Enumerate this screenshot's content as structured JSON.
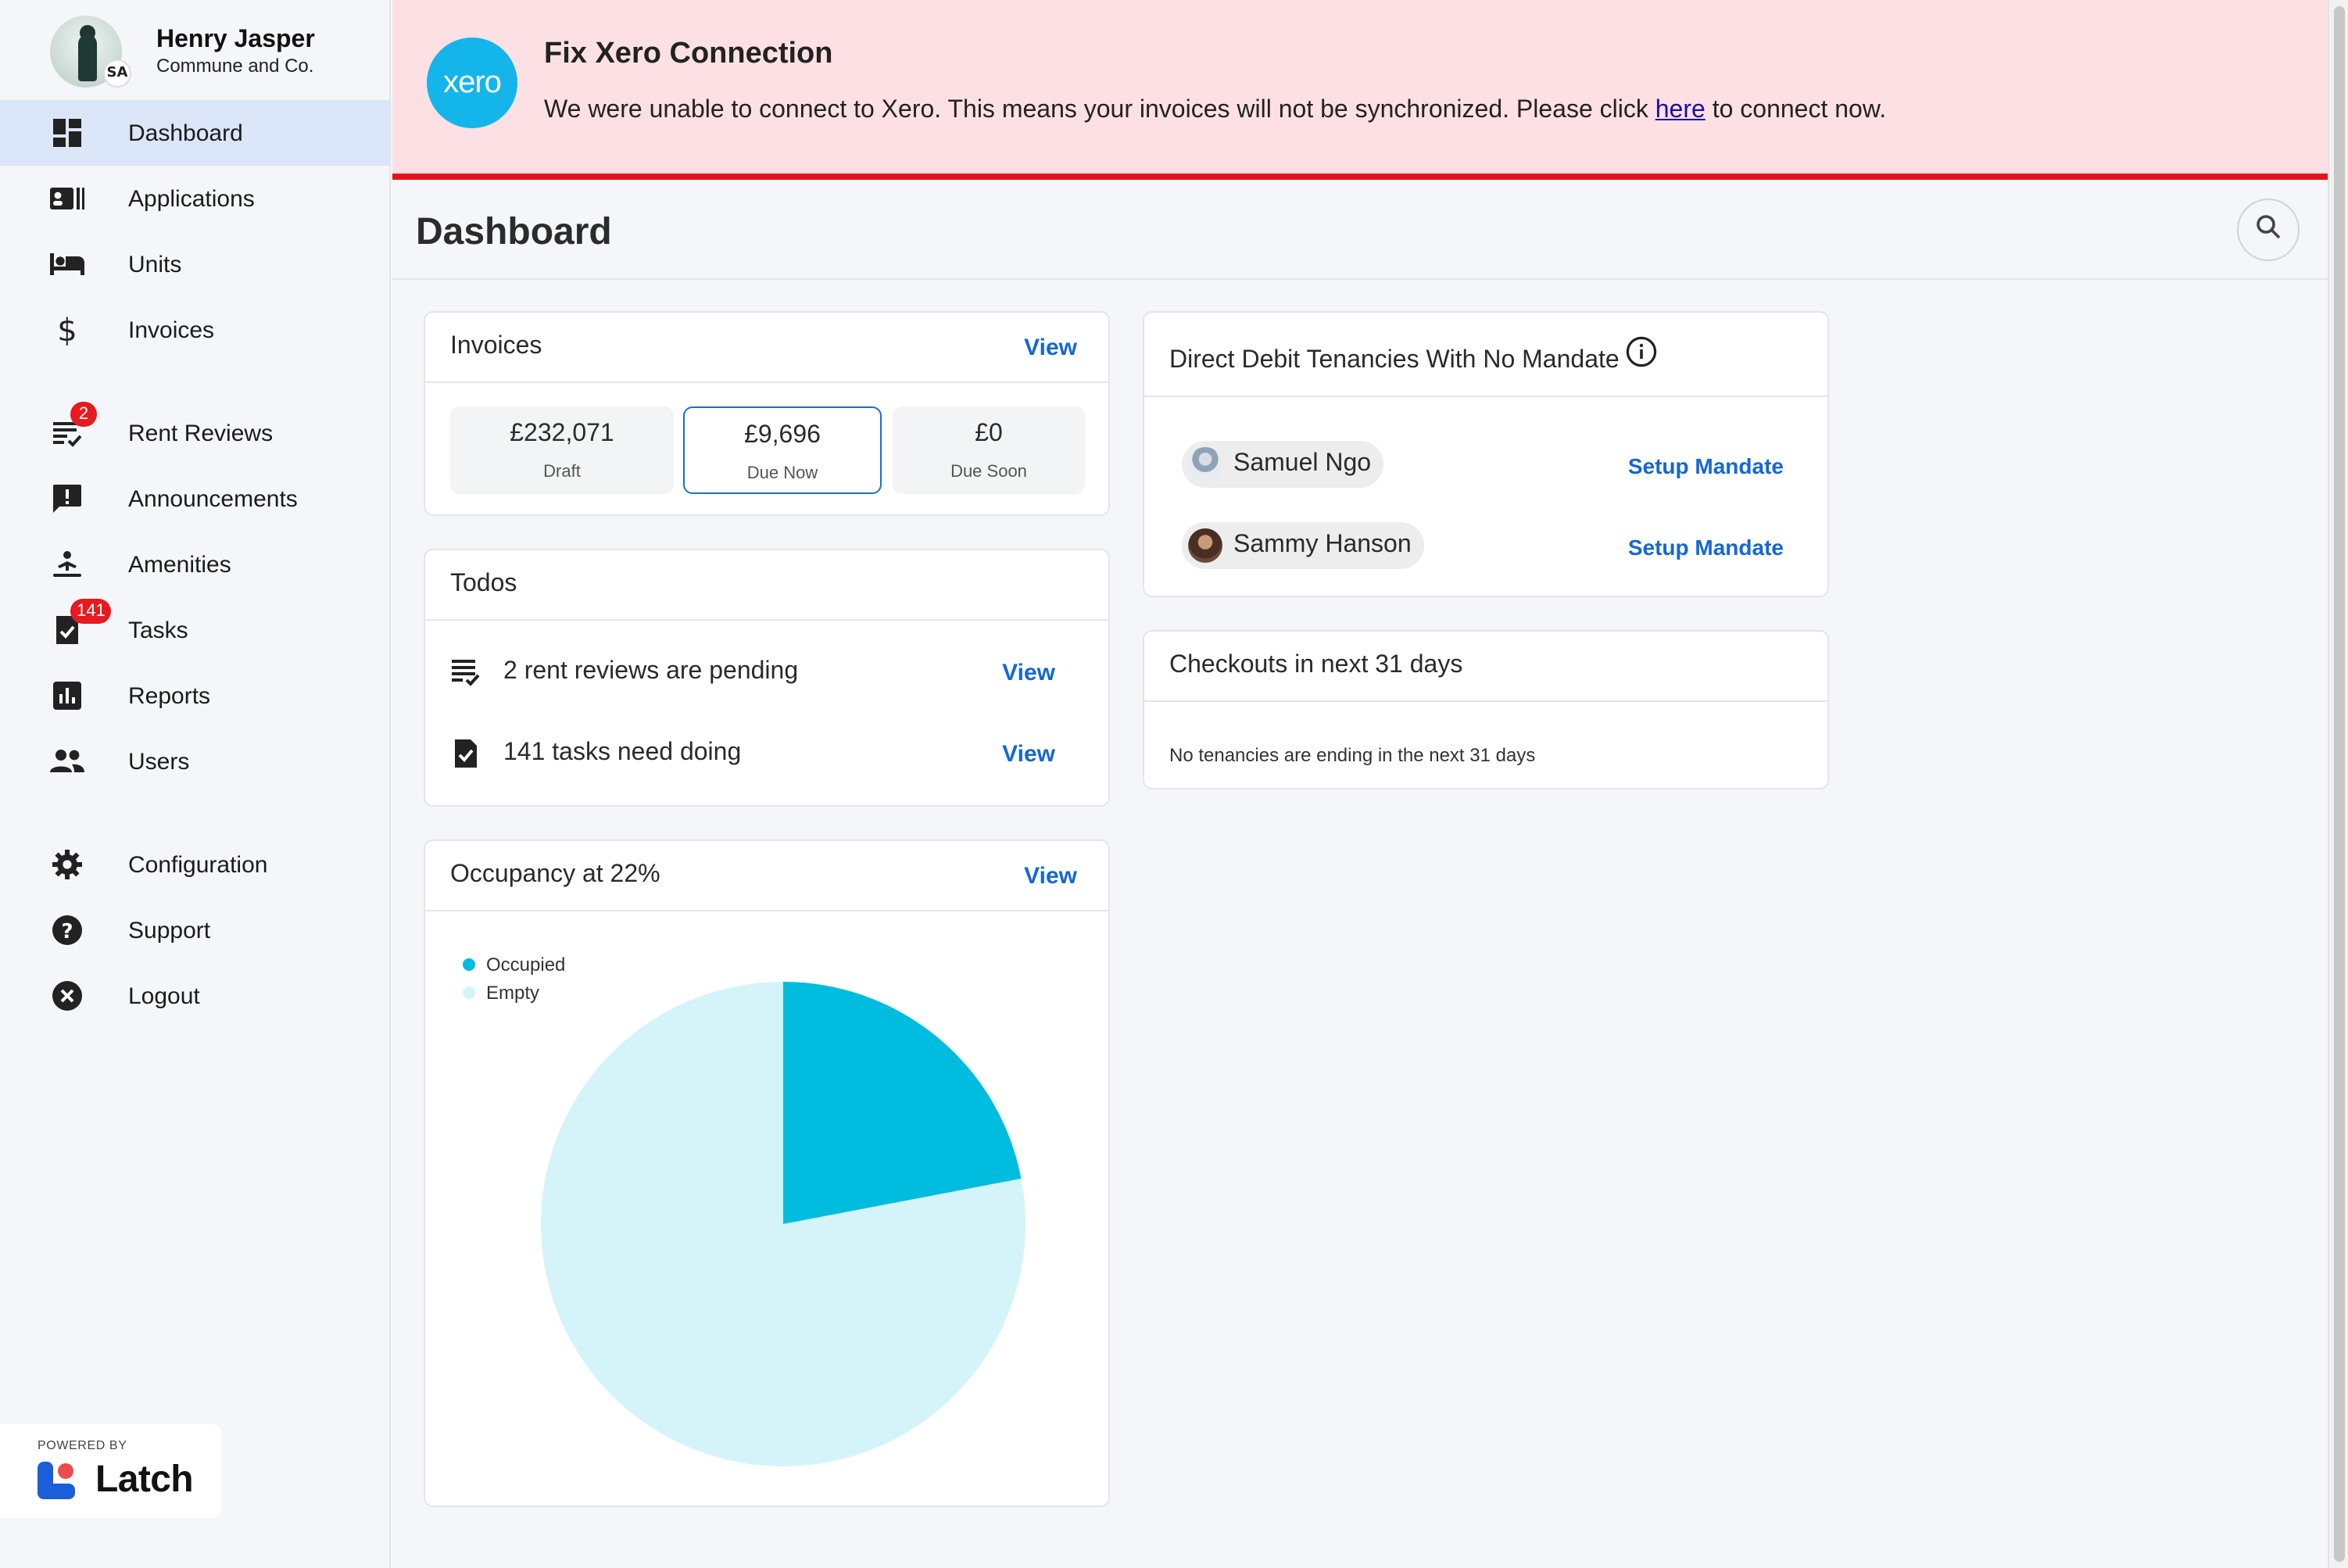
{
  "profile": {
    "name": "Henry Jasper",
    "org": "Commune and Co.",
    "badge_text": "SA"
  },
  "nav": [
    {
      "label": "Dashboard",
      "icon": "dashboard-icon",
      "active": true
    },
    {
      "label": "Applications",
      "icon": "applications-icon"
    },
    {
      "label": "Units",
      "icon": "bed-icon"
    },
    {
      "label": "Invoices",
      "icon": "dollar-icon"
    },
    {
      "label": "Rent Reviews",
      "icon": "checklist-icon",
      "badge": "2"
    },
    {
      "label": "Announcements",
      "icon": "announcement-icon"
    },
    {
      "label": "Amenities",
      "icon": "amenities-icon"
    },
    {
      "label": "Tasks",
      "icon": "task-icon",
      "badge": "141"
    },
    {
      "label": "Reports",
      "icon": "reports-icon"
    },
    {
      "label": "Users",
      "icon": "users-icon"
    },
    {
      "label": "Configuration",
      "icon": "gear-icon"
    },
    {
      "label": "Support",
      "icon": "help-icon"
    },
    {
      "label": "Logout",
      "icon": "logout-icon"
    }
  ],
  "powered": {
    "by": "POWERED BY",
    "brand": "Latch"
  },
  "banner": {
    "logo_text": "xero",
    "title": "Fix Xero Connection",
    "message_before": "We were unable to connect to Xero. This means your invoices will not be synchronized. Please click ",
    "link_text": "here",
    "message_after": " to connect now."
  },
  "header": {
    "title": "Dashboard"
  },
  "invoices": {
    "title": "Invoices",
    "view": "View",
    "boxes": [
      {
        "amount": "£232,071",
        "label": "Draft"
      },
      {
        "amount": "£9,696",
        "label": "Due Now"
      },
      {
        "amount": "£0",
        "label": "Due Soon"
      }
    ]
  },
  "todos": {
    "title": "Todos",
    "items": [
      {
        "text": "2 rent reviews are pending",
        "link": "View"
      },
      {
        "text": "141 tasks need doing",
        "link": "View"
      }
    ]
  },
  "occupancy": {
    "title": "Occupancy at 22%",
    "view": "View"
  },
  "chart_data": {
    "type": "pie",
    "title": "Occupancy at 22%",
    "categories": [
      "Occupied",
      "Empty"
    ],
    "values": [
      22,
      78
    ],
    "colors": [
      "#00bde0",
      "#d4f4fa"
    ],
    "legend": "top-left"
  },
  "mandates": {
    "title": "Direct Debit Tenancies With No Mandate",
    "people": [
      {
        "name": "Samuel Ngo",
        "action": "Setup Mandate"
      },
      {
        "name": "Sammy Hanson",
        "action": "Setup Mandate"
      }
    ]
  },
  "checkouts": {
    "title": "Checkouts in next 31 days",
    "empty": "No tenancies are ending in the next 31 days"
  },
  "colors": {
    "accent": "#1467d6",
    "banner_bg": "#fde0e4",
    "banner_border": "#e5141c",
    "xero": "#13b5ea",
    "active_nav": "#dbe6f8",
    "badge": "#e8191f"
  }
}
